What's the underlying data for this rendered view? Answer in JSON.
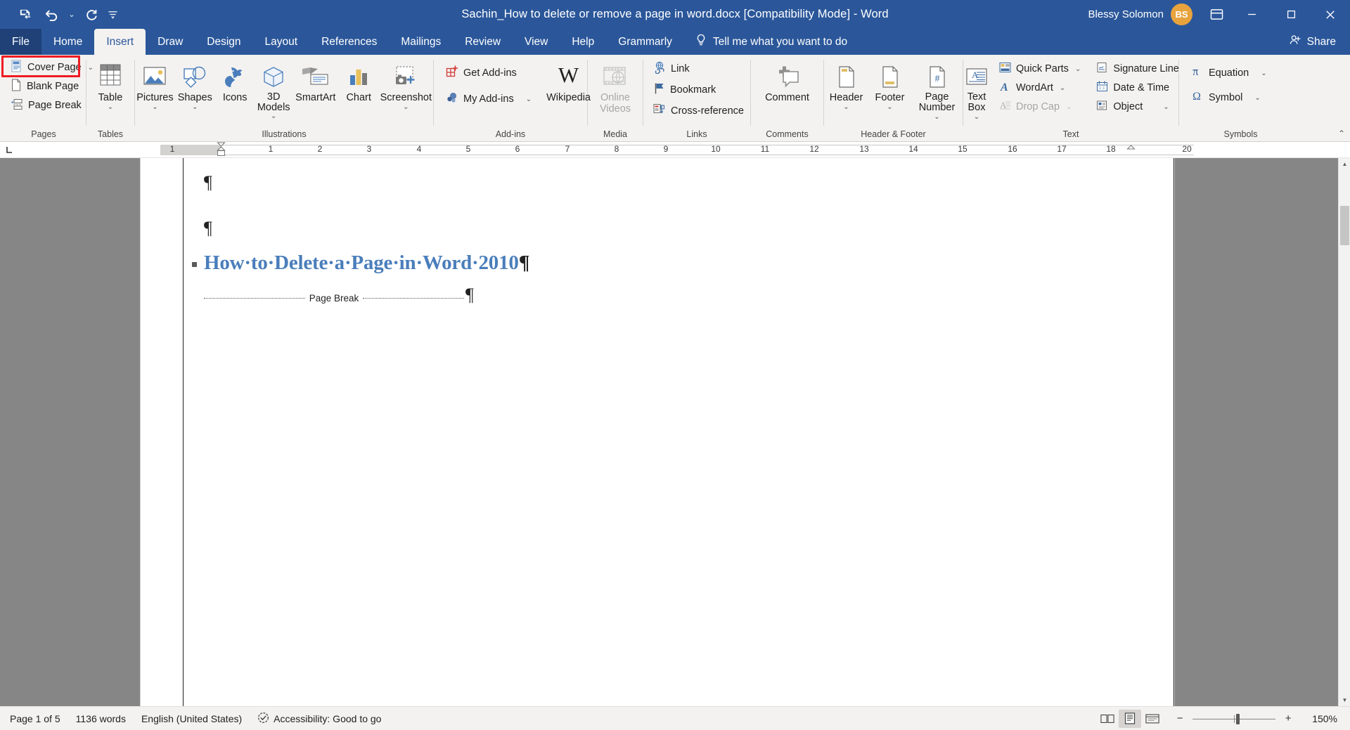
{
  "titlebar": {
    "quick_access": [
      {
        "name": "save-icon",
        "label": "Save"
      },
      {
        "name": "undo-icon",
        "label": "Undo"
      },
      {
        "name": "redo-icon",
        "label": "Redo"
      },
      {
        "name": "customize-qat-icon",
        "label": "Customize Quick Access Toolbar"
      }
    ],
    "document_title": "Sachin_How to delete or remove a page in word.docx [Compatibility Mode]",
    "title_separator": "-",
    "app_name": "Word",
    "account_name": "Blessy Solomon",
    "account_initials": "BS",
    "ribbon_display_options": "Ribbon Display Options",
    "minimize": "Minimize",
    "restore": "Restore Down",
    "close": "Close"
  },
  "tabs": [
    {
      "label": "File",
      "active": false,
      "is_file": true
    },
    {
      "label": "Home",
      "active": false
    },
    {
      "label": "Insert",
      "active": true
    },
    {
      "label": "Draw",
      "active": false
    },
    {
      "label": "Design",
      "active": false
    },
    {
      "label": "Layout",
      "active": false
    },
    {
      "label": "References",
      "active": false
    },
    {
      "label": "Mailings",
      "active": false
    },
    {
      "label": "Review",
      "active": false
    },
    {
      "label": "View",
      "active": false
    },
    {
      "label": "Help",
      "active": false
    },
    {
      "label": "Grammarly",
      "active": false
    }
  ],
  "tellme": {
    "icon": "lightbulb-icon",
    "label": "Tell me what you want to do"
  },
  "share": {
    "icon": "share-person-icon",
    "label": "Share"
  },
  "ribbon": {
    "groups": [
      {
        "name": "Pages",
        "items": [
          {
            "label": "Cover Page",
            "icon": "cover-page-icon",
            "dropdown": true,
            "disabled": false
          },
          {
            "label": "Blank Page",
            "icon": "blank-page-icon",
            "dropdown": false,
            "disabled": false,
            "highlighted": true
          },
          {
            "label": "Page Break",
            "icon": "page-break-icon",
            "dropdown": false,
            "disabled": false
          }
        ]
      },
      {
        "name": "Tables",
        "items": [
          {
            "label": "Table",
            "icon": "table-icon",
            "dropdown": true,
            "disabled": false
          }
        ]
      },
      {
        "name": "Illustrations",
        "items": [
          {
            "label": "Pictures",
            "icon": "pictures-icon",
            "dropdown": true,
            "disabled": false
          },
          {
            "label": "Shapes",
            "icon": "shapes-icon",
            "dropdown": true,
            "disabled": false
          },
          {
            "label": "Icons",
            "icon": "icons-icon",
            "dropdown": false,
            "disabled": false
          },
          {
            "label": "3D Models",
            "icon": "3d-models-icon",
            "dropdown": true,
            "disabled": false
          },
          {
            "label": "SmartArt",
            "icon": "smartart-icon",
            "dropdown": false,
            "disabled": false
          },
          {
            "label": "Chart",
            "icon": "chart-icon",
            "dropdown": false,
            "disabled": false
          },
          {
            "label": "Screenshot",
            "icon": "screenshot-icon",
            "dropdown": true,
            "disabled": false
          }
        ]
      },
      {
        "name": "Add-ins",
        "items": [
          {
            "label": "Get Add-ins",
            "icon": "get-addins-icon",
            "dropdown": false,
            "disabled": false
          },
          {
            "label": "My Add-ins",
            "icon": "my-addins-icon",
            "dropdown": true,
            "disabled": false
          },
          {
            "label": "Wikipedia",
            "icon": "wikipedia-icon",
            "dropdown": false,
            "disabled": false
          }
        ]
      },
      {
        "name": "Media",
        "items": [
          {
            "label": "Online Videos",
            "icon": "online-videos-icon",
            "dropdown": false,
            "disabled": true
          }
        ]
      },
      {
        "name": "Links",
        "items": [
          {
            "label": "Link",
            "icon": "link-icon",
            "dropdown": false,
            "disabled": false
          },
          {
            "label": "Bookmark",
            "icon": "bookmark-icon",
            "dropdown": false,
            "disabled": false
          },
          {
            "label": "Cross-reference",
            "icon": "cross-reference-icon",
            "dropdown": false,
            "disabled": false
          }
        ]
      },
      {
        "name": "Comments",
        "items": [
          {
            "label": "Comment",
            "icon": "comment-icon",
            "dropdown": false,
            "disabled": false
          }
        ]
      },
      {
        "name": "Header & Footer",
        "items": [
          {
            "label": "Header",
            "icon": "header-icon",
            "dropdown": true,
            "disabled": false
          },
          {
            "label": "Footer",
            "icon": "footer-icon",
            "dropdown": true,
            "disabled": false
          },
          {
            "label": "Page Number",
            "icon": "page-number-icon",
            "dropdown": true,
            "disabled": false
          }
        ]
      },
      {
        "name": "Text",
        "items": [
          {
            "label": "Text Box",
            "icon": "text-box-icon",
            "dropdown": true,
            "disabled": false
          },
          {
            "label": "Quick Parts",
            "icon": "quick-parts-icon",
            "dropdown": true,
            "disabled": false
          },
          {
            "label": "WordArt",
            "icon": "wordart-icon",
            "dropdown": true,
            "disabled": false
          },
          {
            "label": "Drop Cap",
            "icon": "drop-cap-icon",
            "dropdown": true,
            "disabled": true
          },
          {
            "label": "Signature Line",
            "icon": "signature-line-icon",
            "dropdown": true,
            "disabled": false
          },
          {
            "label": "Date & Time",
            "icon": "date-time-icon",
            "dropdown": false,
            "disabled": false
          },
          {
            "label": "Object",
            "icon": "object-icon",
            "dropdown": true,
            "disabled": false
          }
        ]
      },
      {
        "name": "Symbols",
        "items": [
          {
            "label": "Equation",
            "icon": "equation-icon",
            "dropdown": true,
            "disabled": false
          },
          {
            "label": "Symbol",
            "icon": "symbol-icon",
            "dropdown": true,
            "disabled": false
          }
        ]
      }
    ]
  },
  "ruler": {
    "tab_selector": "left-tab-stop",
    "numbers": [
      "1",
      "1",
      "2",
      "3",
      "4",
      "5",
      "6",
      "7",
      "8",
      "9",
      "10",
      "11",
      "12",
      "13",
      "14",
      "15",
      "16",
      "17",
      "18",
      "20"
    ]
  },
  "document": {
    "heading": "How·to·Delete·a·Page·in·Word·2010",
    "heading_pilcrow": "¶",
    "pilcrow": "¶",
    "page_break_label": "Page Break",
    "show_formatting_marks": true
  },
  "statusbar": {
    "page_indicator": "Page 1 of 5",
    "word_count": "1136 words",
    "language": "English (United States)",
    "accessibility_icon": "accessibility-icon",
    "accessibility": "Accessibility: Good to go",
    "views": [
      {
        "name": "read-mode-icon",
        "label": "Read Mode",
        "active": false
      },
      {
        "name": "print-layout-icon",
        "label": "Print Layout",
        "active": true
      },
      {
        "name": "web-layout-icon",
        "label": "Web Layout",
        "active": false
      }
    ],
    "zoom_out": "−",
    "zoom_in": "+",
    "zoom_level": "150%"
  },
  "colors": {
    "word_blue": "#2b579a",
    "ribbon_bg": "#f3f2f1",
    "heading_blue": "#4a7ebb",
    "annotation_red": "#ee1c23",
    "avatar_orange": "#e8a33d"
  }
}
